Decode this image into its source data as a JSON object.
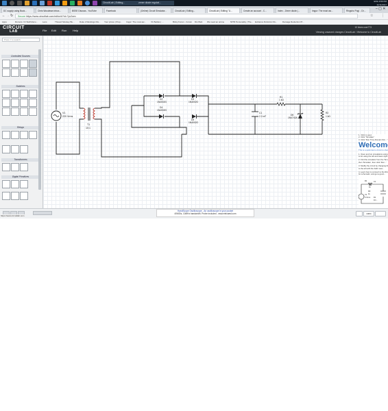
{
  "taskbar": {
    "chips": [
      "DC supply using Buck...",
      "Chris Woodman inbox...",
      "BSSE Discuss - YouTube",
      "Facebook",
      "(Online) Circuit Simulator...",
      "CircuitLab | Editing...",
      "zener diode regulat..."
    ],
    "time": "9:59 PM",
    "date": "11/11/2017",
    "lang": "ENG"
  },
  "tabs": [
    "CircuitLab | Editing...",
    "CircuitLab | Editing \"U...",
    "Create an account - C...",
    "Index - Zener diode (...",
    "Imgur: The most aw...",
    "Ringsho Pogi - Ch..."
  ],
  "address": {
    "secure": "Secure",
    "url": "https://www.circuitlab.com/editor/#?id=7yv2wm"
  },
  "bookmarks": [
    "Apps",
    "Rumors: XJ Staff discu...",
    "Lens",
    "Thread: Monkey Bu...",
    "Duke 2 Rankings Dis...",
    "Your prices | Prep..",
    "Imgur: The most aw...",
    "V1 Battles | ...",
    "Bixby Forum - Forum",
    "Dis Web",
    "We need an anime",
    "MITR Personality | The...",
    "Evidence Robotics Div...",
    "Damage Reduction Pl..."
  ],
  "circuitlab": {
    "logo_line1": "CIRCUIT",
    "logo_line2": "LAB",
    "menus": [
      "File",
      "Edit",
      "Run",
      "Help"
    ],
    "user_line": "10 times  user773",
    "viewing": "Viewing unsaved changes  CircuitLab / Welcome to CircuitLab"
  },
  "panel": {
    "search_placeholder": "Press 'I' to search",
    "categories": [
      "Controlled Sources",
      "Switches",
      "Relays",
      "Transformers",
      "Digital Primitives"
    ]
  },
  "schematic": {
    "v1": [
      "V1",
      "220 Vrms"
    ],
    "t1": "T1",
    "t1_ratio": "10:1",
    "d2": [
      "D2",
      "1N4002G"
    ],
    "d4": [
      "D4",
      "1N4002G"
    ],
    "d3": [
      "D3",
      "1N4002G"
    ],
    "d5": [
      "D5",
      "1N4002G"
    ],
    "r1": [
      "R1",
      "1 kΩ"
    ],
    "c1": [
      "C1",
      "2.2 mF"
    ],
    "d6": [
      "D6",
      "1N4742A"
    ],
    "r2": [
      "R2",
      "1 kΩ"
    ]
  },
  "welcome": {
    "steps": [
      "1. Click to open",
      "2. Click \"Simulate\"",
      "3. Click \"Run Time-Domain Sim...\""
    ],
    "heading": "Welcome",
    "lines": [
      "This is a quick demo circuit to show you...",
      "1. Open and run simulations using these...",
      "to be using the left and lower-right...",
      "2. Find the simulator from the 'Sim...'",
      "then 'Simulate', then click 'Run...'",
      "3. Modify the circuit by changing the...",
      "to the left with the 'Edit' view...",
      "4. Learn how to connect to the library...",
      "for schematic, and get a good..."
    ],
    "circuit_labels": [
      "V1",
      "6 Vrms",
      "R1",
      "1k",
      "C1",
      "R3",
      "1k",
      "D1",
      "1N..."
    ]
  },
  "bottom": {
    "status_url": "https://www.circuitlab.com",
    "ad_line1": "HandScope Oscilloscope - An oscilloscope in your pocket",
    "ad_line2": "40MS/s, 10MHz bandwidth. Probe included - www.elecaesl.com",
    "zoom": "100%"
  },
  "colors": {
    "taskbar": "#0f1720",
    "circuitlab_bar": "#2b2f33",
    "wire": "#222222",
    "accent": "#2f6db5"
  }
}
